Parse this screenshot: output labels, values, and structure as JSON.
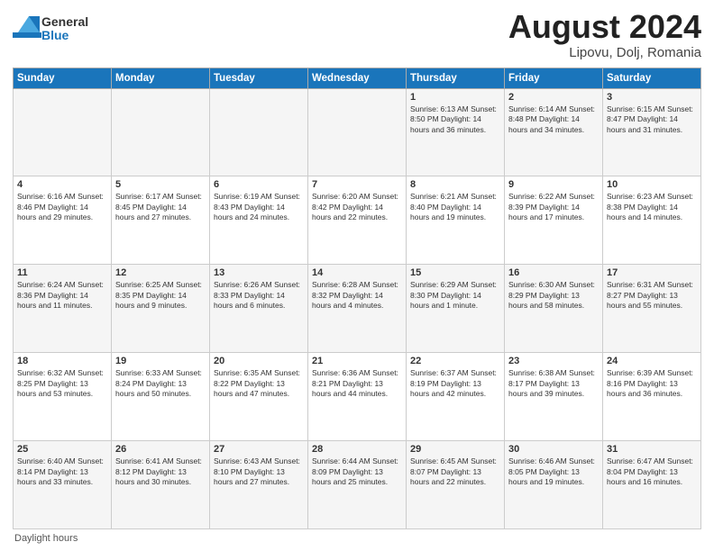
{
  "header": {
    "logo_general": "General",
    "logo_blue": "Blue",
    "title": "August 2024",
    "location": "Lipovu, Dolj, Romania"
  },
  "weekdays": [
    "Sunday",
    "Monday",
    "Tuesday",
    "Wednesday",
    "Thursday",
    "Friday",
    "Saturday"
  ],
  "footer": "Daylight hours",
  "weeks": [
    [
      {
        "day": "",
        "info": ""
      },
      {
        "day": "",
        "info": ""
      },
      {
        "day": "",
        "info": ""
      },
      {
        "day": "",
        "info": ""
      },
      {
        "day": "1",
        "info": "Sunrise: 6:13 AM\nSunset: 8:50 PM\nDaylight: 14 hours and 36 minutes."
      },
      {
        "day": "2",
        "info": "Sunrise: 6:14 AM\nSunset: 8:48 PM\nDaylight: 14 hours and 34 minutes."
      },
      {
        "day": "3",
        "info": "Sunrise: 6:15 AM\nSunset: 8:47 PM\nDaylight: 14 hours and 31 minutes."
      }
    ],
    [
      {
        "day": "4",
        "info": "Sunrise: 6:16 AM\nSunset: 8:46 PM\nDaylight: 14 hours and 29 minutes."
      },
      {
        "day": "5",
        "info": "Sunrise: 6:17 AM\nSunset: 8:45 PM\nDaylight: 14 hours and 27 minutes."
      },
      {
        "day": "6",
        "info": "Sunrise: 6:19 AM\nSunset: 8:43 PM\nDaylight: 14 hours and 24 minutes."
      },
      {
        "day": "7",
        "info": "Sunrise: 6:20 AM\nSunset: 8:42 PM\nDaylight: 14 hours and 22 minutes."
      },
      {
        "day": "8",
        "info": "Sunrise: 6:21 AM\nSunset: 8:40 PM\nDaylight: 14 hours and 19 minutes."
      },
      {
        "day": "9",
        "info": "Sunrise: 6:22 AM\nSunset: 8:39 PM\nDaylight: 14 hours and 17 minutes."
      },
      {
        "day": "10",
        "info": "Sunrise: 6:23 AM\nSunset: 8:38 PM\nDaylight: 14 hours and 14 minutes."
      }
    ],
    [
      {
        "day": "11",
        "info": "Sunrise: 6:24 AM\nSunset: 8:36 PM\nDaylight: 14 hours and 11 minutes."
      },
      {
        "day": "12",
        "info": "Sunrise: 6:25 AM\nSunset: 8:35 PM\nDaylight: 14 hours and 9 minutes."
      },
      {
        "day": "13",
        "info": "Sunrise: 6:26 AM\nSunset: 8:33 PM\nDaylight: 14 hours and 6 minutes."
      },
      {
        "day": "14",
        "info": "Sunrise: 6:28 AM\nSunset: 8:32 PM\nDaylight: 14 hours and 4 minutes."
      },
      {
        "day": "15",
        "info": "Sunrise: 6:29 AM\nSunset: 8:30 PM\nDaylight: 14 hours and 1 minute."
      },
      {
        "day": "16",
        "info": "Sunrise: 6:30 AM\nSunset: 8:29 PM\nDaylight: 13 hours and 58 minutes."
      },
      {
        "day": "17",
        "info": "Sunrise: 6:31 AM\nSunset: 8:27 PM\nDaylight: 13 hours and 55 minutes."
      }
    ],
    [
      {
        "day": "18",
        "info": "Sunrise: 6:32 AM\nSunset: 8:25 PM\nDaylight: 13 hours and 53 minutes."
      },
      {
        "day": "19",
        "info": "Sunrise: 6:33 AM\nSunset: 8:24 PM\nDaylight: 13 hours and 50 minutes."
      },
      {
        "day": "20",
        "info": "Sunrise: 6:35 AM\nSunset: 8:22 PM\nDaylight: 13 hours and 47 minutes."
      },
      {
        "day": "21",
        "info": "Sunrise: 6:36 AM\nSunset: 8:21 PM\nDaylight: 13 hours and 44 minutes."
      },
      {
        "day": "22",
        "info": "Sunrise: 6:37 AM\nSunset: 8:19 PM\nDaylight: 13 hours and 42 minutes."
      },
      {
        "day": "23",
        "info": "Sunrise: 6:38 AM\nSunset: 8:17 PM\nDaylight: 13 hours and 39 minutes."
      },
      {
        "day": "24",
        "info": "Sunrise: 6:39 AM\nSunset: 8:16 PM\nDaylight: 13 hours and 36 minutes."
      }
    ],
    [
      {
        "day": "25",
        "info": "Sunrise: 6:40 AM\nSunset: 8:14 PM\nDaylight: 13 hours and 33 minutes."
      },
      {
        "day": "26",
        "info": "Sunrise: 6:41 AM\nSunset: 8:12 PM\nDaylight: 13 hours and 30 minutes."
      },
      {
        "day": "27",
        "info": "Sunrise: 6:43 AM\nSunset: 8:10 PM\nDaylight: 13 hours and 27 minutes."
      },
      {
        "day": "28",
        "info": "Sunrise: 6:44 AM\nSunset: 8:09 PM\nDaylight: 13 hours and 25 minutes."
      },
      {
        "day": "29",
        "info": "Sunrise: 6:45 AM\nSunset: 8:07 PM\nDaylight: 13 hours and 22 minutes."
      },
      {
        "day": "30",
        "info": "Sunrise: 6:46 AM\nSunset: 8:05 PM\nDaylight: 13 hours and 19 minutes."
      },
      {
        "day": "31",
        "info": "Sunrise: 6:47 AM\nSunset: 8:04 PM\nDaylight: 13 hours and 16 minutes."
      }
    ]
  ]
}
